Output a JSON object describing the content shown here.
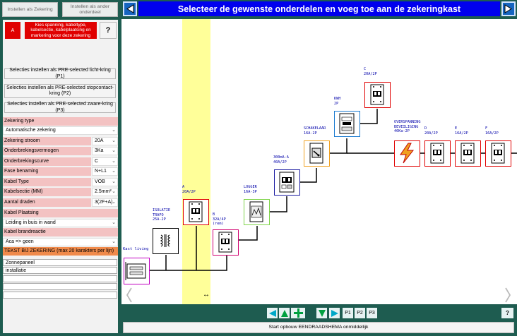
{
  "left": {
    "tab_settings": "Instellen als Zekering",
    "tab_other": "Instellen als ander onderdeel",
    "red_icon_text": "A",
    "red_info": "Kies spanning, kabeltype, kabelsectie, kabelplaatsing en markering voor deze zekering",
    "help": "?",
    "preset_p1": "Selecties instellen als PRE-selected licht-kring (P1)",
    "preset_p2": "Selecties instellen als PRE-selected stopcontact-kring (P2)",
    "preset_p3": "Selecties instellen als PRE-selected zware-kring (P3)",
    "zekering_type_label": "Zekering type",
    "zekering_type_value": "Automatische zekering",
    "fields": [
      {
        "label": "Zekering stroom",
        "value": "20A"
      },
      {
        "label": "Onderbrekingsvermogen",
        "value": "3Ka"
      },
      {
        "label": "Onderbrekingscurve",
        "value": "C"
      },
      {
        "label": "Fase benaming",
        "value": "N+L1"
      },
      {
        "label": "Kabel Type",
        "value": "VOB"
      },
      {
        "label": "Kabelsectie (MM)",
        "value": "2.5mm²"
      },
      {
        "label": "Aantal draden",
        "value": "3(2F+A)"
      }
    ],
    "kabel_plaatsing_label": "Kabel Plaatsing",
    "kabel_plaatsing_value": "Leiding in buis in wand",
    "brandreactie_label": "Kabel brandreactie",
    "brandreactie_value": "Aca => geen",
    "text_header": "TEKST BIJ ZEKERING (max 20 karakters per lijn)",
    "text_lines": [
      "Zonnepaneel",
      "installatie",
      "",
      "",
      ""
    ]
  },
  "title": "Selecteer de gewenste onderdelen en voeg toe aan de zekeringkast",
  "components": {
    "kast": "Kast living",
    "isolatie": "ISOLATIE\nTRAFO\n25A-2P",
    "a": "A\n20A/2P",
    "b": "B\n32A/4P\n(rem)",
    "logger": "LOGGER\n16A-3P",
    "diff": "300mA-A\n40A/2P",
    "schakelaar": "SCHAKELAAR\n16A-2P",
    "kwh": "KWH\n2P",
    "c": "C\n20A/2P",
    "overspanning": "OVERSPANNING\nBEVEILIGING\n40Ka-2P",
    "d": "D\n20A/2P",
    "e": "E\n16A/2P",
    "f": "F\n16A/2P"
  },
  "toolbar": {
    "p1": "P1",
    "p2": "P2",
    "p3": "P3",
    "help": "?"
  },
  "start_button": "Start opbouw EENDRAADSHEMA onmiddellijk",
  "colors": {
    "accent_blue": "#0000ee",
    "background": "#1e5c50",
    "highlight": "#ffff99",
    "alert_red": "#e00000"
  }
}
